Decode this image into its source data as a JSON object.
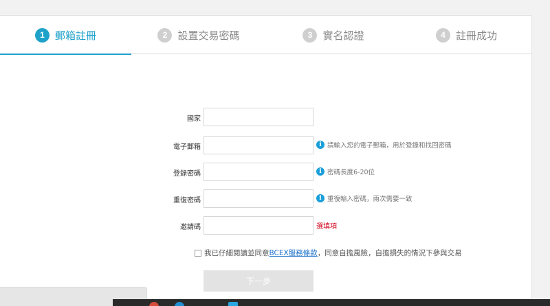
{
  "steps": [
    {
      "num": "1",
      "label": "郵箱註冊"
    },
    {
      "num": "2",
      "label": "設置交易密碼"
    },
    {
      "num": "3",
      "label": "實名認證"
    },
    {
      "num": "4",
      "label": "註冊成功"
    }
  ],
  "form": {
    "country": {
      "label": "國家"
    },
    "email": {
      "label": "電子郵箱",
      "hint": "請輸入您的電子郵箱，用於登錄和找回密碼"
    },
    "password": {
      "label": "登錄密碼",
      "hint": "密碼長度6-20位"
    },
    "confirm": {
      "label": "重復密碼",
      "hint": "重復輸入密碼，兩次需要一致"
    },
    "invite": {
      "label": "邀請碼",
      "hint": "選填項"
    }
  },
  "agreement": {
    "prefix": "我已仔細閱讀並同意",
    "link": "BCEX服務條款",
    "suffix": "，同意自擔風險，自擔損失的情況下參與交易"
  },
  "next_button": "下一步",
  "colors": {
    "accent": "#1fa2c9",
    "info": "#1a9fd9",
    "optional": "#d0021b"
  },
  "icons": {
    "info": "info-icon"
  }
}
